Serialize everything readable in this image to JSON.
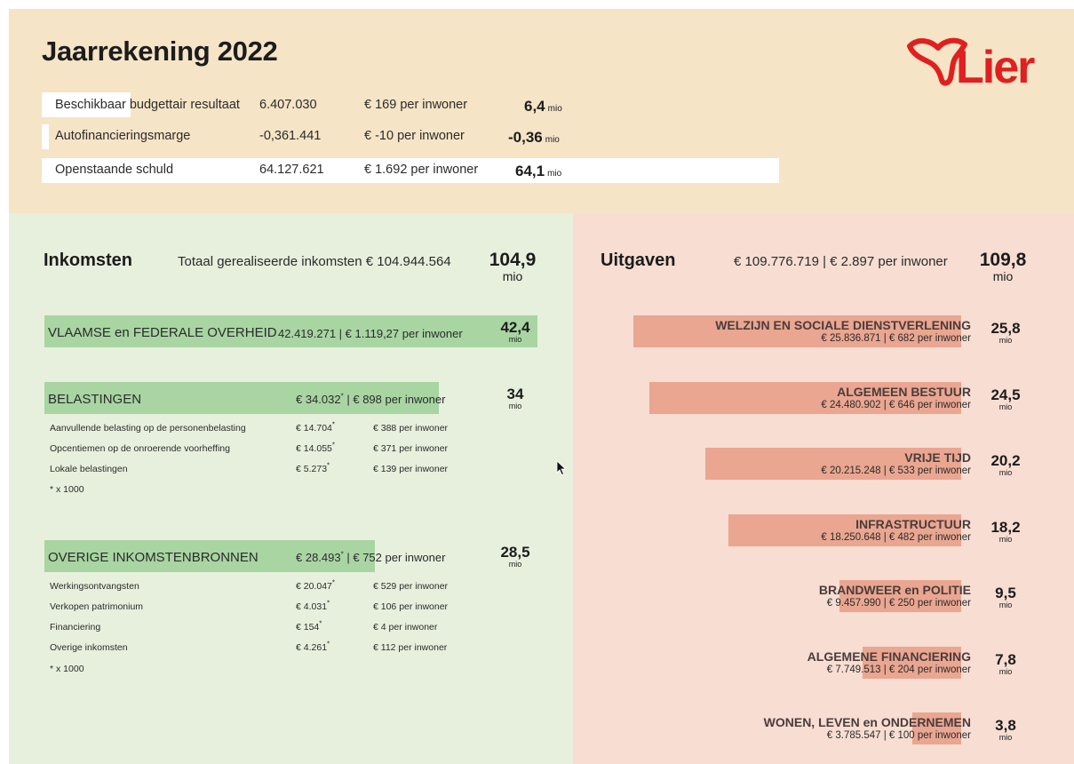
{
  "header": {
    "title": "Jaarrekening 2022",
    "logo_text": "Lier",
    "kpis": [
      {
        "label": "Beschikbaar budgettair resultaat",
        "amount": "6.407.030",
        "per_inwoner": "€ 169 per inwoner",
        "big": "6,4",
        "unit": "mio",
        "bar_fraction": 0.12
      },
      {
        "label": "Autofinancieringsmarge",
        "amount": "-0,361.441",
        "per_inwoner": "€ -10 per inwoner",
        "big": "-0,36",
        "unit": "mio",
        "bar_fraction": 0.01
      },
      {
        "label": "Openstaande schuld",
        "amount": "64.127.621",
        "per_inwoner": "€ 1.692 per inwoner",
        "big": "64,1",
        "unit": "mio",
        "bar_fraction": 1.0
      }
    ]
  },
  "inkomsten": {
    "title": "Inkomsten",
    "subtitle": "Totaal gerealiseerde inkomsten € 104.944.564",
    "total": "104,9",
    "unit": "mio",
    "categories": [
      {
        "name": "VLAAMSE en FEDERALE OVERHEID",
        "detail": "42.419.271 | € 1.119,27 per inwoner",
        "big": "42,4",
        "unit": "mio",
        "bar_fraction": 1.0
      },
      {
        "name": "BELASTINGEN",
        "amount": "€ 34.032",
        "star": "*",
        "per_inwoner": "| € 898 per inwoner",
        "big": "34",
        "unit": "mio",
        "bar_fraction": 0.8,
        "rows": [
          {
            "label": "Aanvullende belasting op de personenbelasting",
            "amount": "€ 14.704",
            "star": "*",
            "per": "€ 388 per inwoner"
          },
          {
            "label": "Opcentiemen op de onroerende voorheffing",
            "amount": "€ 14.055",
            "star": "*",
            "per": "€ 371 per inwoner"
          },
          {
            "label": "Lokale belastingen",
            "amount": "€ 5.273",
            "star": "*",
            "per": "€ 139 per inwoner"
          }
        ],
        "note": "* x 1000"
      },
      {
        "name": "OVERIGE INKOMSTENBRONNEN",
        "amount": "€ 28.493",
        "star": "*",
        "per_inwoner": "| € 752 per inwoner",
        "big": "28,5",
        "unit": "mio",
        "bar_fraction": 0.67,
        "rows": [
          {
            "label": "Werkingsontvangsten",
            "amount": "€ 20.047",
            "star": "*",
            "per": "€ 529 per inwoner"
          },
          {
            "label": "Verkopen patrimonium",
            "amount": "€ 4.031",
            "star": "*",
            "per": "€ 106 per inwoner"
          },
          {
            "label": "Financiering",
            "amount": "€ 154",
            "star": "*",
            "per": "€ 4 per inwoner"
          },
          {
            "label": "Overige inkomsten",
            "amount": "€ 4.261",
            "star": "*",
            "per": "€ 112 per inwoner"
          }
        ],
        "note": "* x 1000"
      }
    ]
  },
  "uitgaven": {
    "title": "Uitgaven",
    "subtitle": "€ 109.776.719 | € 2.897 per inwoner",
    "total": "109,8",
    "unit": "mio",
    "categories": [
      {
        "name": "WELZIJN EN SOCIALE DIENSTVERLENING",
        "detail": "€ 25.836.871 | € 682 per inwoner",
        "big": "25,8",
        "unit": "mio",
        "bar_fraction": 1.0
      },
      {
        "name": "ALGEMEEN BESTUUR",
        "detail": "€ 24.480.902 | € 646 per inwoner",
        "big": "24,5",
        "unit": "mio",
        "bar_fraction": 0.95
      },
      {
        "name": "VRIJE TIJD",
        "detail": "€ 20.215.248 | € 533 per inwoner",
        "big": "20,2",
        "unit": "mio",
        "bar_fraction": 0.78
      },
      {
        "name": "INFRASTRUCTUUR",
        "detail": "€ 18.250.648 | € 482 per inwoner",
        "big": "18,2",
        "unit": "mio",
        "bar_fraction": 0.71
      },
      {
        "name": "BRANDWEER en POLITIE",
        "detail": "€ 9.457.990 | € 250 per inwoner",
        "big": "9,5",
        "unit": "mio",
        "bar_fraction": 0.37
      },
      {
        "name": "ALGEMENE FINANCIERING",
        "detail": "€ 7.749.513 | € 204 per inwoner",
        "big": "7,8",
        "unit": "mio",
        "bar_fraction": 0.3
      },
      {
        "name": "WONEN, LEVEN en ONDERNEMEN",
        "detail": "€ 3.785.547 | € 100 per inwoner",
        "big": "3,8",
        "unit": "mio",
        "bar_fraction": 0.15
      }
    ]
  },
  "colors": {
    "header_bg": "#f5e4c6",
    "income_bg": "#e7f0dd",
    "income_bar": "#a8d5a2",
    "expense_bg": "#f7ddd2",
    "expense_bar": "#eaa690",
    "logo_red": "#e02020"
  },
  "icons": {
    "logo": "lier-sheep-logo-icon",
    "cursor": "mouse-pointer-icon"
  }
}
